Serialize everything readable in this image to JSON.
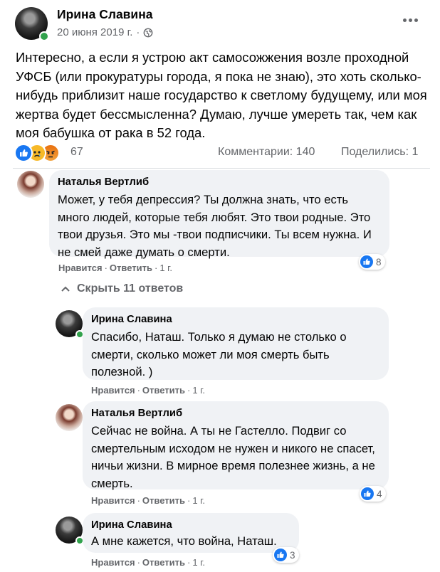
{
  "post": {
    "author": "Ирина Славина",
    "date": "20 июня 2019 г.",
    "date_sep": "·",
    "text": "Интересно, а если я устрою акт самосожжения возле проходной УФСБ (или прокуратуры города, я пока не знаю), это хоть сколько-нибудь приблизит наше государство к светлому будущему, или моя жертва будет бессмысленна? Думаю, лучше умереть так, чем как моя бабушка от рака в 52 года."
  },
  "reactions": {
    "types": [
      "like-icon",
      "sad-icon",
      "angry-icon"
    ],
    "count": "67",
    "comments": "Комментарии: 140",
    "shares": "Поделились: 1"
  },
  "hide_replies": "Скрыть 11 ответов",
  "actions": {
    "like": "Нравится",
    "reply": "Ответить",
    "sep": "·"
  },
  "comments": [
    {
      "author": "Наталья Вертлиб",
      "text": "Может, у тебя депрессия? Ты должна знать, что есть много людей, которые тебя любят. Это твои родные. Это твои друзья. Это мы -твои подписчики. Ты всем нужна. И не смей даже думать о смерти.",
      "time": "1 г.",
      "likes": "8"
    },
    {
      "author": "Ирина Славина",
      "text": "Спасибо, Наташ. Только я думаю не столько о смерти, сколько может ли моя смерть быть полезной. )",
      "time": "1 г."
    },
    {
      "author": "Наталья Вертлиб",
      "text": "Сейчас не война. А ты не Гастелло. Подвиг со смертельным исходом не нужен и никого не спасет, ничьи жизни. В мирное время полезнее жизнь, а не смерть.",
      "time": "1 г.",
      "likes": "4"
    },
    {
      "author": "Ирина Славина",
      "text": "А мне кажется, что война, Наташ.",
      "time": "1 г.",
      "likes": "3"
    }
  ],
  "colors": {
    "like_blue": "#1877f2",
    "online_green": "#31a24c",
    "bubble_bg": "#f0f2f5",
    "meta_gray": "#65676b"
  }
}
